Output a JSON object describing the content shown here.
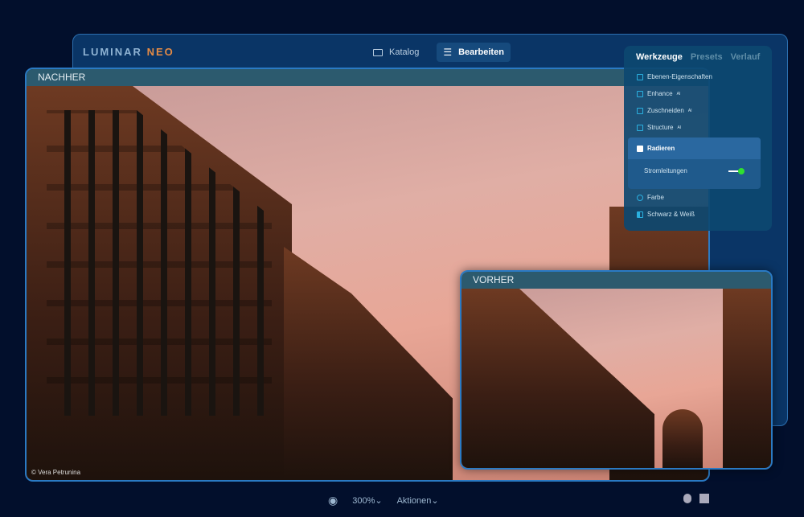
{
  "app": {
    "logo_main": "LUMINAR",
    "logo_accent": "NEO"
  },
  "nav": {
    "catalog": "Katalog",
    "edit": "Bearbeiten"
  },
  "after": {
    "title": "NACHHER",
    "credit": "© Vera Petrunina"
  },
  "before": {
    "title": "VORHER"
  },
  "tools": {
    "tabs": [
      "Werkzeuge",
      "Presets",
      "Verlauf"
    ],
    "items": [
      {
        "label": "Ebenen-Eigenschaften",
        "ai": ""
      },
      {
        "label": "Enhance",
        "ai": "AI"
      },
      {
        "label": "Zuschneiden",
        "ai": "AI"
      },
      {
        "label": "Structure",
        "ai": "AI"
      }
    ],
    "selected": "Radieren",
    "option": "Stromleitungen",
    "option_on": true,
    "items2": [
      {
        "label": "Farbe"
      },
      {
        "label": "Schwarz & Weiß"
      }
    ]
  },
  "bottom": {
    "zoom": "300%",
    "actions": "Aktionen"
  }
}
